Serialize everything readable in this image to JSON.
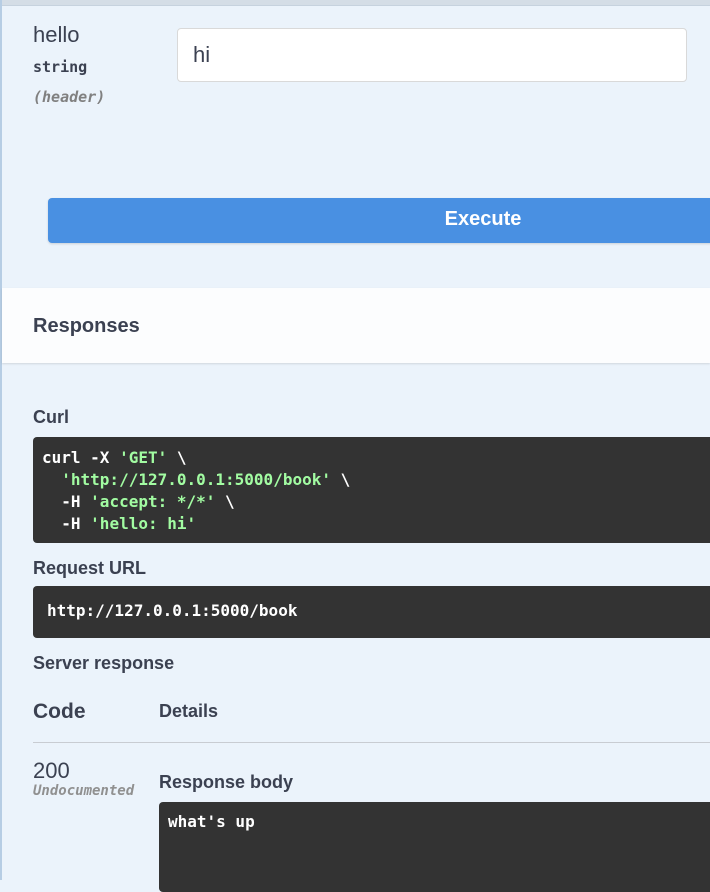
{
  "parameter": {
    "name": "hello",
    "type": "string",
    "location": "(header)",
    "value": "hi"
  },
  "execute_label": "Execute",
  "responses": {
    "title": "Responses",
    "curl_label": "Curl",
    "curl": {
      "l1_cmd": "curl -X ",
      "l1_method": "'GET'",
      "l1_tail": " \\",
      "l2_indent": "  ",
      "l2_url": "'http://127.0.0.1:5000/book'",
      "l2_tail": " \\",
      "l3_flag": "  -H ",
      "l3_val": "'accept: */*'",
      "l3_tail": " \\",
      "l4_flag": "  -H ",
      "l4_val": "'hello: hi'"
    },
    "request_url_label": "Request URL",
    "request_url": "http://127.0.0.1:5000/book",
    "server_response_label": "Server response",
    "col_code": "Code",
    "col_details": "Details",
    "status_code": "200",
    "status_note": "Undocumented",
    "response_body_label": "Response body",
    "response_body": "what's up"
  }
}
